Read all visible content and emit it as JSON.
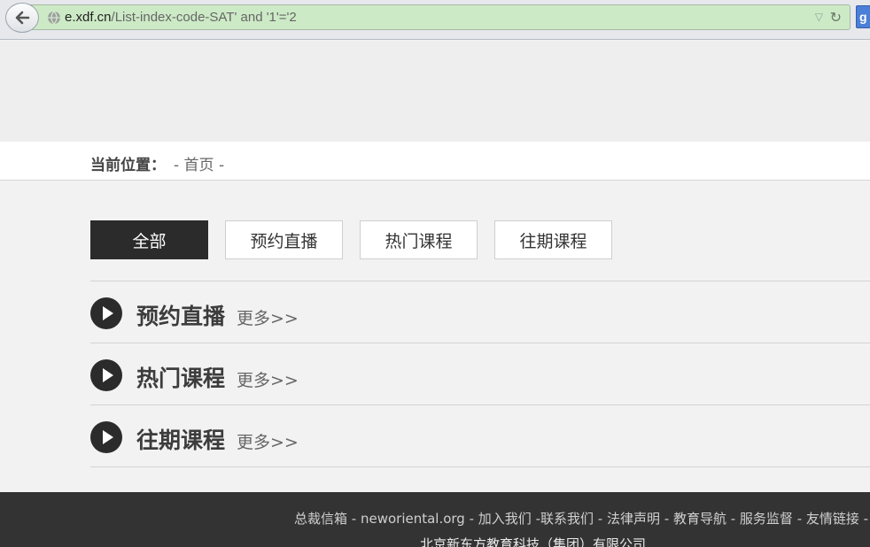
{
  "browser": {
    "url_host": "e.xdf.cn",
    "url_path": "/List-index-code-SAT' and '1'='2"
  },
  "breadcrumb": {
    "label": "当前位置：",
    "home": "- 首页 -"
  },
  "tabs": [
    {
      "label": "全部",
      "active": true
    },
    {
      "label": "预约直播",
      "active": false
    },
    {
      "label": "热门课程",
      "active": false
    },
    {
      "label": "往期课程",
      "active": false
    }
  ],
  "sections": [
    {
      "title": "预约直播",
      "more": "更多>>"
    },
    {
      "title": "热门课程",
      "more": "更多>>"
    },
    {
      "title": "往期课程",
      "more": "更多>>"
    }
  ],
  "footer": {
    "links": [
      "总裁信箱",
      "neworiental.org",
      "加入我们",
      "联系我们",
      "法律声明",
      "教育导航",
      "服务监督",
      "友情链接"
    ],
    "separator": " - ",
    "company": "北京新东方教育科技（集团）有限公司"
  }
}
